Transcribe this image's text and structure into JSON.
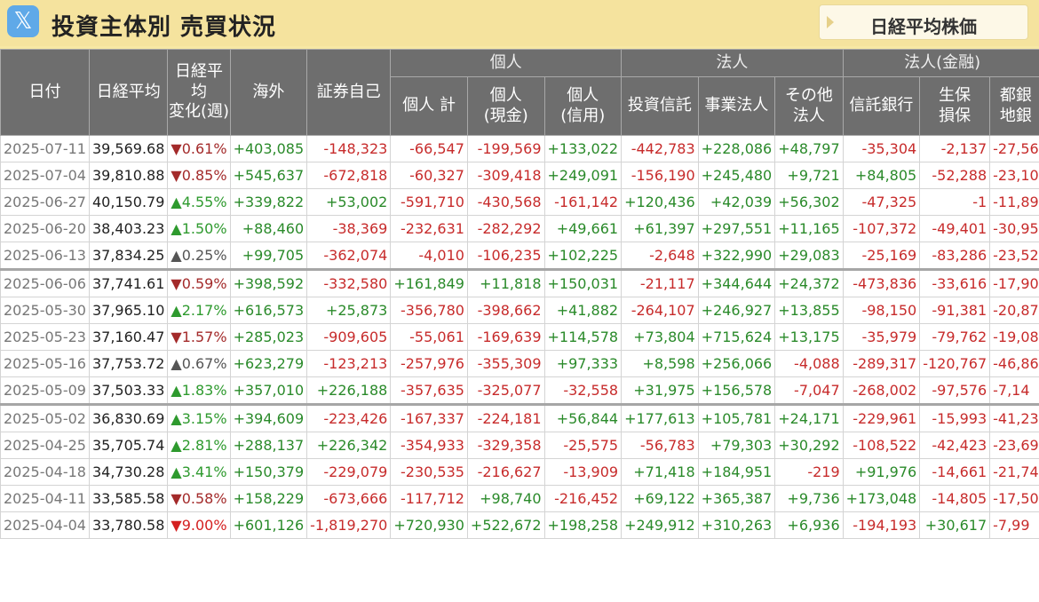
{
  "header": {
    "logo_icon": "x-logo-icon",
    "logo_glyph": "𝕏",
    "title": "投資主体別 売買状況"
  },
  "nav": {
    "nikkei_button": "日経平均株価"
  },
  "table": {
    "group_headers": {
      "individual": "個人",
      "corporate": "法人",
      "financial": "法人(金融)"
    },
    "columns": {
      "date": "日付",
      "nikkei": "日経平均",
      "change_l1": "日経平均",
      "change_l2": "変化(週)",
      "foreign": "海外",
      "proprietary": "証券自己",
      "ind_total": "個人 計",
      "ind_cash_l1": "個人",
      "ind_cash_l2": "(現金)",
      "ind_margin_l1": "個人",
      "ind_margin_l2": "(信用)",
      "investment_trust": "投資信託",
      "business": "事業法人",
      "other_l1": "その他",
      "other_l2": "法人",
      "trust_bank": "信託銀行",
      "insurance_l1": "生保",
      "insurance_l2": "損保",
      "city_bank_l1": "都銀",
      "city_bank_l2": "地銀"
    },
    "rows": [
      {
        "date": "2025-07-11",
        "nikkei": "39,569.68",
        "dir": "down",
        "change": "0.61%",
        "foreign": "+403,085",
        "proprietary": "-148,323",
        "ind_total": "-66,547",
        "ind_cash": "-199,569",
        "ind_margin": "+133,022",
        "inv_trust": "-442,783",
        "business": "+228,086",
        "other": "+48,797",
        "trust_bank": "-35,304",
        "insurance": "-2,137",
        "city_bank": "-27,56"
      },
      {
        "date": "2025-07-04",
        "nikkei": "39,810.88",
        "dir": "down",
        "change": "0.85%",
        "foreign": "+545,637",
        "proprietary": "-672,818",
        "ind_total": "-60,327",
        "ind_cash": "-309,418",
        "ind_margin": "+249,091",
        "inv_trust": "-156,190",
        "business": "+245,480",
        "other": "+9,721",
        "trust_bank": "+84,805",
        "insurance": "-52,288",
        "city_bank": "-23,10"
      },
      {
        "date": "2025-06-27",
        "nikkei": "40,150.79",
        "dir": "up",
        "change": "4.55%",
        "foreign": "+339,822",
        "proprietary": "+53,002",
        "ind_total": "-591,710",
        "ind_cash": "-430,568",
        "ind_margin": "-161,142",
        "inv_trust": "+120,436",
        "business": "+42,039",
        "other": "+56,302",
        "trust_bank": "-47,325",
        "insurance": "-1",
        "city_bank": "-11,89"
      },
      {
        "date": "2025-06-20",
        "nikkei": "38,403.23",
        "dir": "up",
        "change": "1.50%",
        "foreign": "+88,460",
        "proprietary": "-38,369",
        "ind_total": "-232,631",
        "ind_cash": "-282,292",
        "ind_margin": "+49,661",
        "inv_trust": "+61,397",
        "business": "+297,551",
        "other": "+11,165",
        "trust_bank": "-107,372",
        "insurance": "-49,401",
        "city_bank": "-30,95"
      },
      {
        "date": "2025-06-13",
        "nikkei": "37,834.25",
        "dir": "flat",
        "change": "0.25%",
        "foreign": "+99,705",
        "proprietary": "-362,074",
        "ind_total": "-4,010",
        "ind_cash": "-106,235",
        "ind_margin": "+102,225",
        "inv_trust": "-2,648",
        "business": "+322,990",
        "other": "+29,083",
        "trust_bank": "-25,169",
        "insurance": "-83,286",
        "city_bank": "-23,52"
      },
      {
        "date": "2025-06-06",
        "nikkei": "37,741.61",
        "dir": "down",
        "change": "0.59%",
        "foreign": "+398,592",
        "proprietary": "-332,580",
        "ind_total": "+161,849",
        "ind_cash": "+11,818",
        "ind_margin": "+150,031",
        "inv_trust": "-21,117",
        "business": "+344,644",
        "other": "+24,372",
        "trust_bank": "-473,836",
        "insurance": "-33,616",
        "city_bank": "-17,90"
      },
      {
        "date": "2025-05-30",
        "nikkei": "37,965.10",
        "dir": "up",
        "change": "2.17%",
        "foreign": "+616,573",
        "proprietary": "+25,873",
        "ind_total": "-356,780",
        "ind_cash": "-398,662",
        "ind_margin": "+41,882",
        "inv_trust": "-264,107",
        "business": "+246,927",
        "other": "+13,855",
        "trust_bank": "-98,150",
        "insurance": "-91,381",
        "city_bank": "-20,87"
      },
      {
        "date": "2025-05-23",
        "nikkei": "37,160.47",
        "dir": "down",
        "change": "1.57%",
        "foreign": "+285,023",
        "proprietary": "-909,605",
        "ind_total": "-55,061",
        "ind_cash": "-169,639",
        "ind_margin": "+114,578",
        "inv_trust": "+73,804",
        "business": "+715,624",
        "other": "+13,175",
        "trust_bank": "-35,979",
        "insurance": "-79,762",
        "city_bank": "-19,08"
      },
      {
        "date": "2025-05-16",
        "nikkei": "37,753.72",
        "dir": "flat",
        "change": "0.67%",
        "foreign": "+623,279",
        "proprietary": "-123,213",
        "ind_total": "-257,976",
        "ind_cash": "-355,309",
        "ind_margin": "+97,333",
        "inv_trust": "+8,598",
        "business": "+256,066",
        "other": "-4,088",
        "trust_bank": "-289,317",
        "insurance": "-120,767",
        "city_bank": "-46,86"
      },
      {
        "date": "2025-05-09",
        "nikkei": "37,503.33",
        "dir": "up",
        "change": "1.83%",
        "foreign": "+357,010",
        "proprietary": "+226,188",
        "ind_total": "-357,635",
        "ind_cash": "-325,077",
        "ind_margin": "-32,558",
        "inv_trust": "+31,975",
        "business": "+156,578",
        "other": "-7,047",
        "trust_bank": "-268,002",
        "insurance": "-97,576",
        "city_bank": "-7,14"
      },
      {
        "date": "2025-05-02",
        "nikkei": "36,830.69",
        "dir": "up",
        "change": "3.15%",
        "foreign": "+394,609",
        "proprietary": "-223,426",
        "ind_total": "-167,337",
        "ind_cash": "-224,181",
        "ind_margin": "+56,844",
        "inv_trust": "+177,613",
        "business": "+105,781",
        "other": "+24,171",
        "trust_bank": "-229,961",
        "insurance": "-15,993",
        "city_bank": "-41,23"
      },
      {
        "date": "2025-04-25",
        "nikkei": "35,705.74",
        "dir": "up",
        "change": "2.81%",
        "foreign": "+288,137",
        "proprietary": "+226,342",
        "ind_total": "-354,933",
        "ind_cash": "-329,358",
        "ind_margin": "-25,575",
        "inv_trust": "-56,783",
        "business": "+79,303",
        "other": "+30,292",
        "trust_bank": "-108,522",
        "insurance": "-42,423",
        "city_bank": "-23,69"
      },
      {
        "date": "2025-04-18",
        "nikkei": "34,730.28",
        "dir": "up",
        "change": "3.41%",
        "foreign": "+150,379",
        "proprietary": "-229,079",
        "ind_total": "-230,535",
        "ind_cash": "-216,627",
        "ind_margin": "-13,909",
        "inv_trust": "+71,418",
        "business": "+184,951",
        "other": "-219",
        "trust_bank": "+91,976",
        "insurance": "-14,661",
        "city_bank": "-21,74"
      },
      {
        "date": "2025-04-11",
        "nikkei": "33,585.58",
        "dir": "down",
        "change": "0.58%",
        "foreign": "+158,229",
        "proprietary": "-673,666",
        "ind_total": "-117,712",
        "ind_cash": "+98,740",
        "ind_margin": "-216,452",
        "inv_trust": "+69,122",
        "business": "+365,387",
        "other": "+9,736",
        "trust_bank": "+173,048",
        "insurance": "-14,805",
        "city_bank": "-17,50"
      },
      {
        "date": "2025-04-04",
        "nikkei": "33,780.58",
        "dir": "bigdown",
        "change": "9.00%",
        "foreign": "+601,126",
        "proprietary": "-1,819,270",
        "ind_total": "+720,930",
        "ind_cash": "+522,672",
        "ind_margin": "+198,258",
        "inv_trust": "+249,912",
        "business": "+310,263",
        "other": "+6,936",
        "trust_bank": "-194,193",
        "insurance": "+30,617",
        "city_bank": "-7,99"
      }
    ]
  },
  "colors": {
    "header_bg": "#6e6e6e",
    "topbar_bg": "#f5e39e",
    "positive": "#2a8a2a",
    "negative": "#c72b2b",
    "arrow_up": "#2e9a2e",
    "arrow_down": "#a32a2a"
  },
  "arrows": {
    "up": "▲",
    "down": "▼"
  }
}
